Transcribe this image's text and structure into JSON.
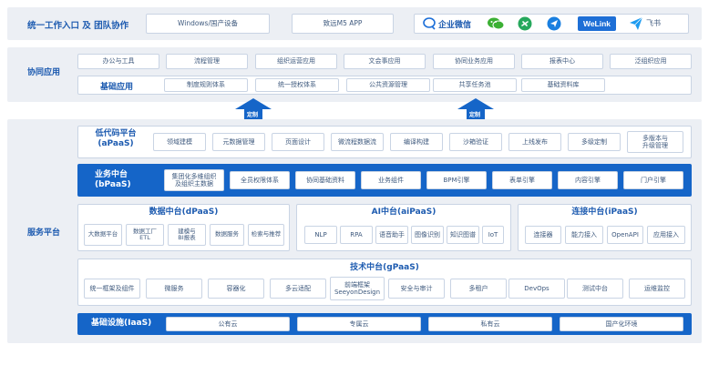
{
  "header": {
    "title": "统一工作入口 及 团队协作",
    "entries": [
      "Windows/国产设备",
      "致远M5 APP"
    ],
    "apps": {
      "wecom": "企业微信",
      "welink": "WeLink",
      "feishu": "飞书"
    }
  },
  "collab": {
    "label": "协同应用",
    "apps": [
      "办公与工具",
      "流程管理",
      "组织运营应用",
      "文会事应用",
      "协同业务应用",
      "报表中心",
      "泛组织应用"
    ],
    "base_label": "基础应用",
    "base_items": [
      "制度规则体系",
      "统一授权体系",
      "公共资源管理",
      "共享任务池",
      "基础资料库"
    ]
  },
  "arrows": [
    "定制",
    "定制"
  ],
  "platform": {
    "label": "服务平台",
    "apaas": {
      "title": "低代码平台\n(aPaaS)",
      "items": [
        "领域建模",
        "元数据管理",
        "页面设计",
        "微流程数据流",
        "编译构建",
        "沙箱验证",
        "上线发布",
        "多级定制",
        "多版本与\n升级管理"
      ]
    },
    "bpaas": {
      "title": "业务中台\n(bPaaS)",
      "items": [
        "集团化多维组织\n及组织主数据",
        "全员权限体系",
        "协同基础资料",
        "业务组件",
        "BPM引擎",
        "表单引擎",
        "内容引擎",
        "门户引擎"
      ]
    },
    "dpaas": {
      "title": "数据中台(dPaaS)",
      "items": [
        "大数据平台",
        "数据工厂\nETL",
        "建模与\nBI报表",
        "数据服务",
        "检索与推荐"
      ]
    },
    "aipaas": {
      "title": "AI中台(aiPaaS)",
      "items": [
        "NLP",
        "RPA",
        "语音助手",
        "图像识别",
        "知识图谱",
        "IoT"
      ]
    },
    "ipaas": {
      "title": "连接中台(iPaaS)",
      "items": [
        "连接器",
        "能力接入",
        "OpenAPI",
        "应用接入"
      ]
    },
    "gpaas": {
      "title": "技术中台(gPaaS)",
      "items": [
        "统一框架及组件",
        "微服务",
        "容器化",
        "多云适配",
        "前端框架\nSeeyonDesign",
        "安全与审计",
        "多租户",
        "DevOps",
        "测试中台",
        "运维监控"
      ]
    },
    "iaas": {
      "title": "基础设施(IaaS)",
      "items": [
        "公有云",
        "专属云",
        "私有云",
        "国产化环境"
      ]
    }
  },
  "colors": {
    "primary_blue": "#1565c8",
    "title_blue": "#1d5bb0",
    "band_gray": "#eceff4",
    "border": "#c9d4e4",
    "wechat_green": "#3cb034",
    "feishu_blue": "#1d9bf0"
  }
}
